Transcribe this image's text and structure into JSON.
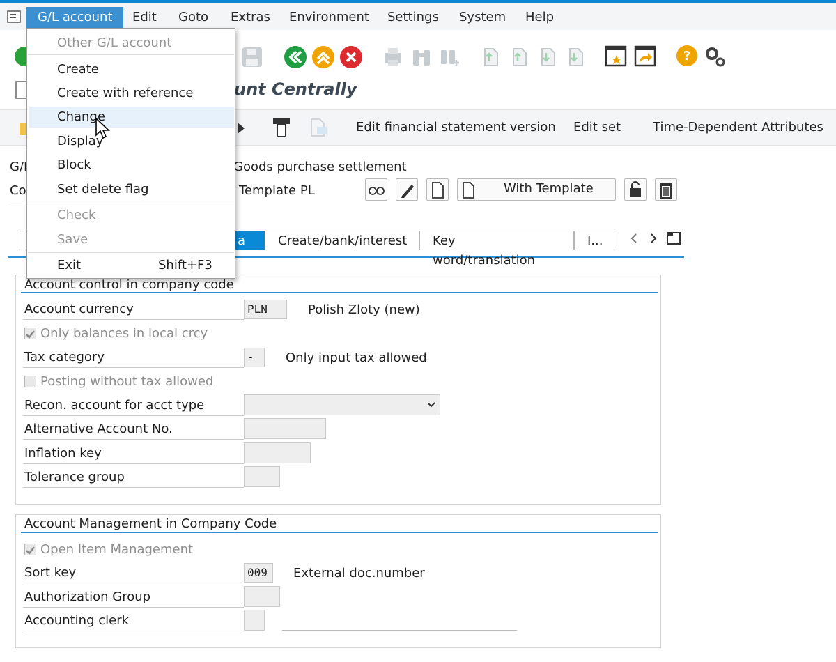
{
  "menubar": {
    "items": [
      {
        "label": "G/L account",
        "active": true
      },
      {
        "label": "Edit"
      },
      {
        "label": "Goto"
      },
      {
        "label": "Extras"
      },
      {
        "label": "Environment"
      },
      {
        "label": "Settings"
      },
      {
        "label": "System"
      },
      {
        "label": "Help"
      }
    ]
  },
  "dropdown": {
    "items": [
      {
        "label": "Other G/L account",
        "disabled": true
      },
      {
        "label": "Create"
      },
      {
        "label": "Create with reference"
      },
      {
        "label": "Change",
        "hover": true
      },
      {
        "label": "Display"
      },
      {
        "label": "Block"
      },
      {
        "label": "Set delete flag"
      },
      {
        "label": "Check",
        "disabled": true
      },
      {
        "label": "Save",
        "disabled": true
      },
      {
        "label": "Exit",
        "shortcut": "Shift+F3"
      }
    ]
  },
  "title": "unt Centrally",
  "apptoolbar": {
    "edit_fsv": "Edit financial statement version",
    "edit_set": "Edit set",
    "time_dep": "Time-Dependent Attributes"
  },
  "header": {
    "gl_label": "G/L",
    "gl_desc": "Goods purchase settlement",
    "co_label": "Co",
    "co_desc": "Template PL",
    "with_template": "With Template"
  },
  "tabs": [
    {
      "label": "a",
      "active": true
    },
    {
      "label": "Create/bank/interest"
    },
    {
      "label": "Key word/translation"
    },
    {
      "label": "I..."
    }
  ],
  "group1": {
    "title": "Account control in company code",
    "account_currency_label": "Account currency",
    "account_currency_value": "PLN",
    "account_currency_desc": "Polish Zloty (new)",
    "only_balances_label": "Only balances in local crcy",
    "tax_category_label": "Tax category",
    "tax_category_value": "-",
    "tax_category_desc": "Only input tax allowed",
    "posting_without_tax_label": "Posting without tax allowed",
    "recon_label": "Recon. account for acct type",
    "alt_account_label": "Alternative Account No.",
    "inflation_label": "Inflation key",
    "tolerance_label": "Tolerance group"
  },
  "group2": {
    "title": "Account Management in Company Code",
    "open_item_label": "Open Item Management",
    "sort_key_label": "Sort key",
    "sort_key_value": "009",
    "sort_key_desc": "External doc.number",
    "auth_group_label": "Authorization Group",
    "clerk_label": "Accounting clerk"
  },
  "colors": {
    "accent": "#0a8ad6",
    "menu_active": "#3a90d0",
    "green_btn": "#2aa23a",
    "orange_btn": "#f0a400",
    "red_btn": "#dd2a30"
  }
}
